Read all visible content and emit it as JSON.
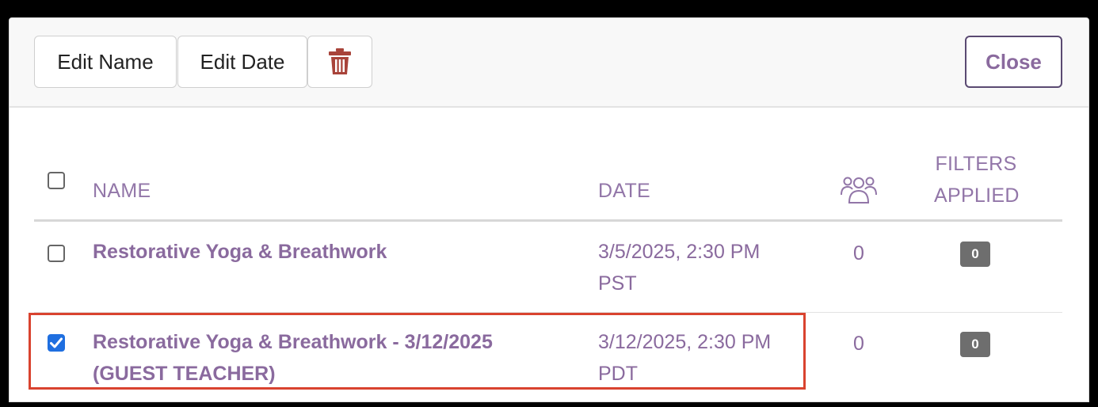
{
  "toolbar": {
    "edit_name_label": "Edit Name",
    "edit_date_label": "Edit Date",
    "delete_icon": "trash-icon",
    "close_label": "Close"
  },
  "table": {
    "headers": {
      "name": "NAME",
      "date": "DATE",
      "attendees_icon": "people-icon",
      "filters_line1": "FILTERS",
      "filters_line2": "APPLIED"
    },
    "rows": [
      {
        "checked": false,
        "name_line1": "Restorative Yoga & Breathwork",
        "name_line2": "",
        "date_line1": "3/5/2025, 2:30 PM",
        "date_line2": "PST",
        "attendees": "0",
        "filters_applied": "0"
      },
      {
        "checked": true,
        "name_line1": "Restorative Yoga & Breathwork - 3/12/2025",
        "name_line2": "(GUEST TEACHER)",
        "date_line1": "3/12/2025, 2:30 PM",
        "date_line2": "PDT",
        "attendees": "0",
        "filters_applied": "0"
      }
    ]
  },
  "colors": {
    "accent": "#8a6a9e",
    "header_text": "#9276a8",
    "checkbox_checked": "#1f6fe0",
    "delete_icon": "#a8433a",
    "highlight_border": "#d9432f",
    "badge": "#6e6e6e"
  }
}
